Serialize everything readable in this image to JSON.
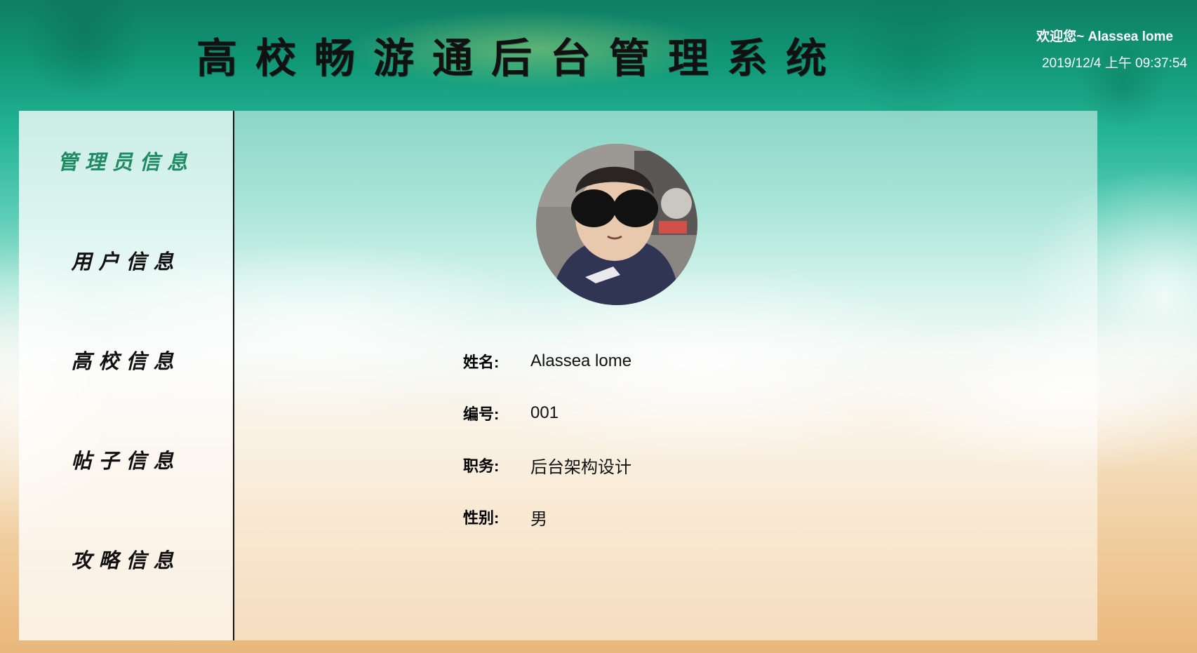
{
  "header": {
    "title": "高校畅游通后台管理系统",
    "welcome_prefix": "欢迎您~",
    "username": "Alassea lome",
    "datetime": "2019/12/4 上午 09:37:54"
  },
  "sidebar": {
    "items": [
      {
        "label": "管理员信息",
        "active": true
      },
      {
        "label": "用户信息",
        "active": false
      },
      {
        "label": "高校信息",
        "active": false
      },
      {
        "label": "帖子信息",
        "active": false
      },
      {
        "label": "攻略信息",
        "active": false
      }
    ]
  },
  "profile": {
    "fields": [
      {
        "label": "姓名:",
        "value": "Alassea lome"
      },
      {
        "label": "编号:",
        "value": "001"
      },
      {
        "label": "职务:",
        "value": "后台架构设计"
      },
      {
        "label": "性别:",
        "value": "男"
      }
    ]
  },
  "colors": {
    "active_menu": "#1e8a62",
    "sidebar_border": "#111111"
  }
}
